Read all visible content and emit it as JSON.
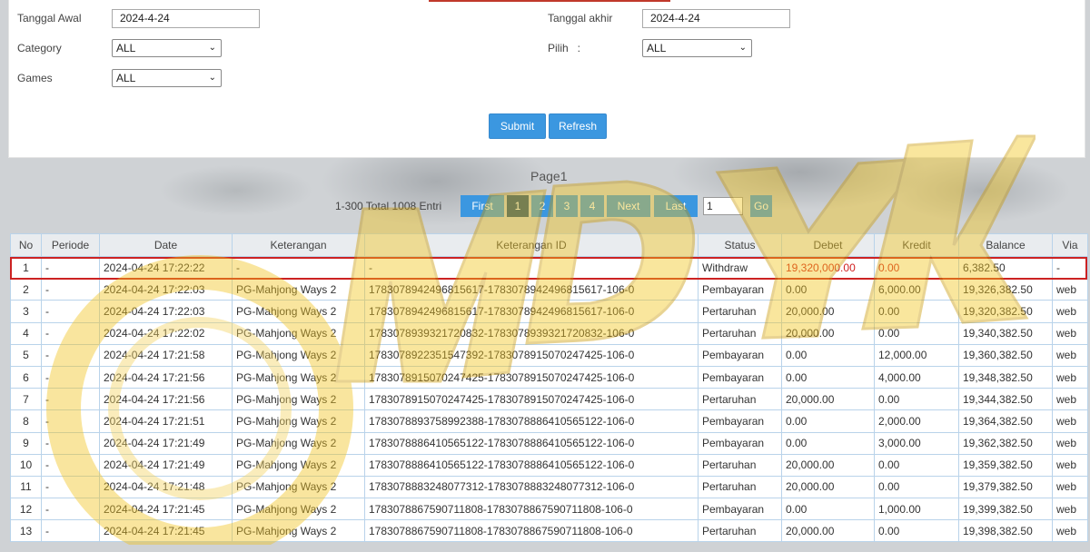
{
  "filters": {
    "start_date_label": "Tanggal Awal",
    "start_date_value": "2024-4-24",
    "end_date_label": "Tanggal akhir",
    "end_date_value": "2024-4-24",
    "category_label": "Category",
    "category_value": "ALL",
    "choose_label": "Pilih   :",
    "choose_value": "ALL",
    "games_label": "Games",
    "games_value": "ALL",
    "submit_label": "Submit",
    "refresh_label": "Refresh"
  },
  "pager": {
    "title": "Page1",
    "info": "1-300 Total 1008 Entri",
    "first_label": "First",
    "pages": [
      "1",
      "2",
      "3",
      "4"
    ],
    "active_page": "1",
    "next_label": "Next",
    "last_label": "Last",
    "goto_value": "1",
    "go_label": "Go"
  },
  "table": {
    "columns": [
      "No",
      "Periode",
      "Date",
      "Keterangan",
      "Keterangan ID",
      "Status",
      "Debet",
      "Kredit",
      "Balance",
      "Via"
    ],
    "rows": [
      [
        "1",
        "-",
        "2024-04-24 17:22:22",
        "-",
        "-",
        "Withdraw",
        "19,320,000.00",
        "0.00",
        "6,382.50",
        "-"
      ],
      [
        "2",
        "-",
        "2024-04-24 17:22:03",
        "PG-Mahjong Ways 2",
        "1783078942496815617-1783078942496815617-106-0",
        "Pembayaran",
        "0.00",
        "6,000.00",
        "19,326,382.50",
        "web"
      ],
      [
        "3",
        "-",
        "2024-04-24 17:22:03",
        "PG-Mahjong Ways 2",
        "1783078942496815617-1783078942496815617-106-0",
        "Pertaruhan",
        "20,000.00",
        "0.00",
        "19,320,382.50",
        "web"
      ],
      [
        "4",
        "-",
        "2024-04-24 17:22:02",
        "PG-Mahjong Ways 2",
        "1783078939321720832-1783078939321720832-106-0",
        "Pertaruhan",
        "20,000.00",
        "0.00",
        "19,340,382.50",
        "web"
      ],
      [
        "5",
        "-",
        "2024-04-24 17:21:58",
        "PG-Mahjong Ways 2",
        "1783078922351547392-1783078915070247425-106-0",
        "Pembayaran",
        "0.00",
        "12,000.00",
        "19,360,382.50",
        "web"
      ],
      [
        "6",
        "-",
        "2024-04-24 17:21:56",
        "PG-Mahjong Ways 2",
        "1783078915070247425-1783078915070247425-106-0",
        "Pembayaran",
        "0.00",
        "4,000.00",
        "19,348,382.50",
        "web"
      ],
      [
        "7",
        "-",
        "2024-04-24 17:21:56",
        "PG-Mahjong Ways 2",
        "1783078915070247425-1783078915070247425-106-0",
        "Pertaruhan",
        "20,000.00",
        "0.00",
        "19,344,382.50",
        "web"
      ],
      [
        "8",
        "-",
        "2024-04-24 17:21:51",
        "PG-Mahjong Ways 2",
        "1783078893758992388-1783078886410565122-106-0",
        "Pembayaran",
        "0.00",
        "2,000.00",
        "19,364,382.50",
        "web"
      ],
      [
        "9",
        "-",
        "2024-04-24 17:21:49",
        "PG-Mahjong Ways 2",
        "1783078886410565122-1783078886410565122-106-0",
        "Pembayaran",
        "0.00",
        "3,000.00",
        "19,362,382.50",
        "web"
      ],
      [
        "10",
        "-",
        "2024-04-24 17:21:49",
        "PG-Mahjong Ways 2",
        "1783078886410565122-1783078886410565122-106-0",
        "Pertaruhan",
        "20,000.00",
        "0.00",
        "19,359,382.50",
        "web"
      ],
      [
        "11",
        "-",
        "2024-04-24 17:21:48",
        "PG-Mahjong Ways 2",
        "1783078883248077312-1783078883248077312-106-0",
        "Pertaruhan",
        "20,000.00",
        "0.00",
        "19,379,382.50",
        "web"
      ],
      [
        "12",
        "-",
        "2024-04-24 17:21:45",
        "PG-Mahjong Ways 2",
        "1783078867590711808-1783078867590711808-106-0",
        "Pembayaran",
        "0.00",
        "1,000.00",
        "19,399,382.50",
        "web"
      ],
      [
        "13",
        "-",
        "2024-04-24 17:21:45",
        "PG-Mahjong Ways 2",
        "1783078867590711808-1783078867590711808-106-0",
        "Pertaruhan",
        "20,000.00",
        "0.00",
        "19,398,382.50",
        "web"
      ]
    ]
  },
  "colors": {
    "button_blue": "#3b97e0",
    "active_page": "#1d4e7a",
    "highlight_red": "#cc2222",
    "negative_red": "#d02020"
  }
}
